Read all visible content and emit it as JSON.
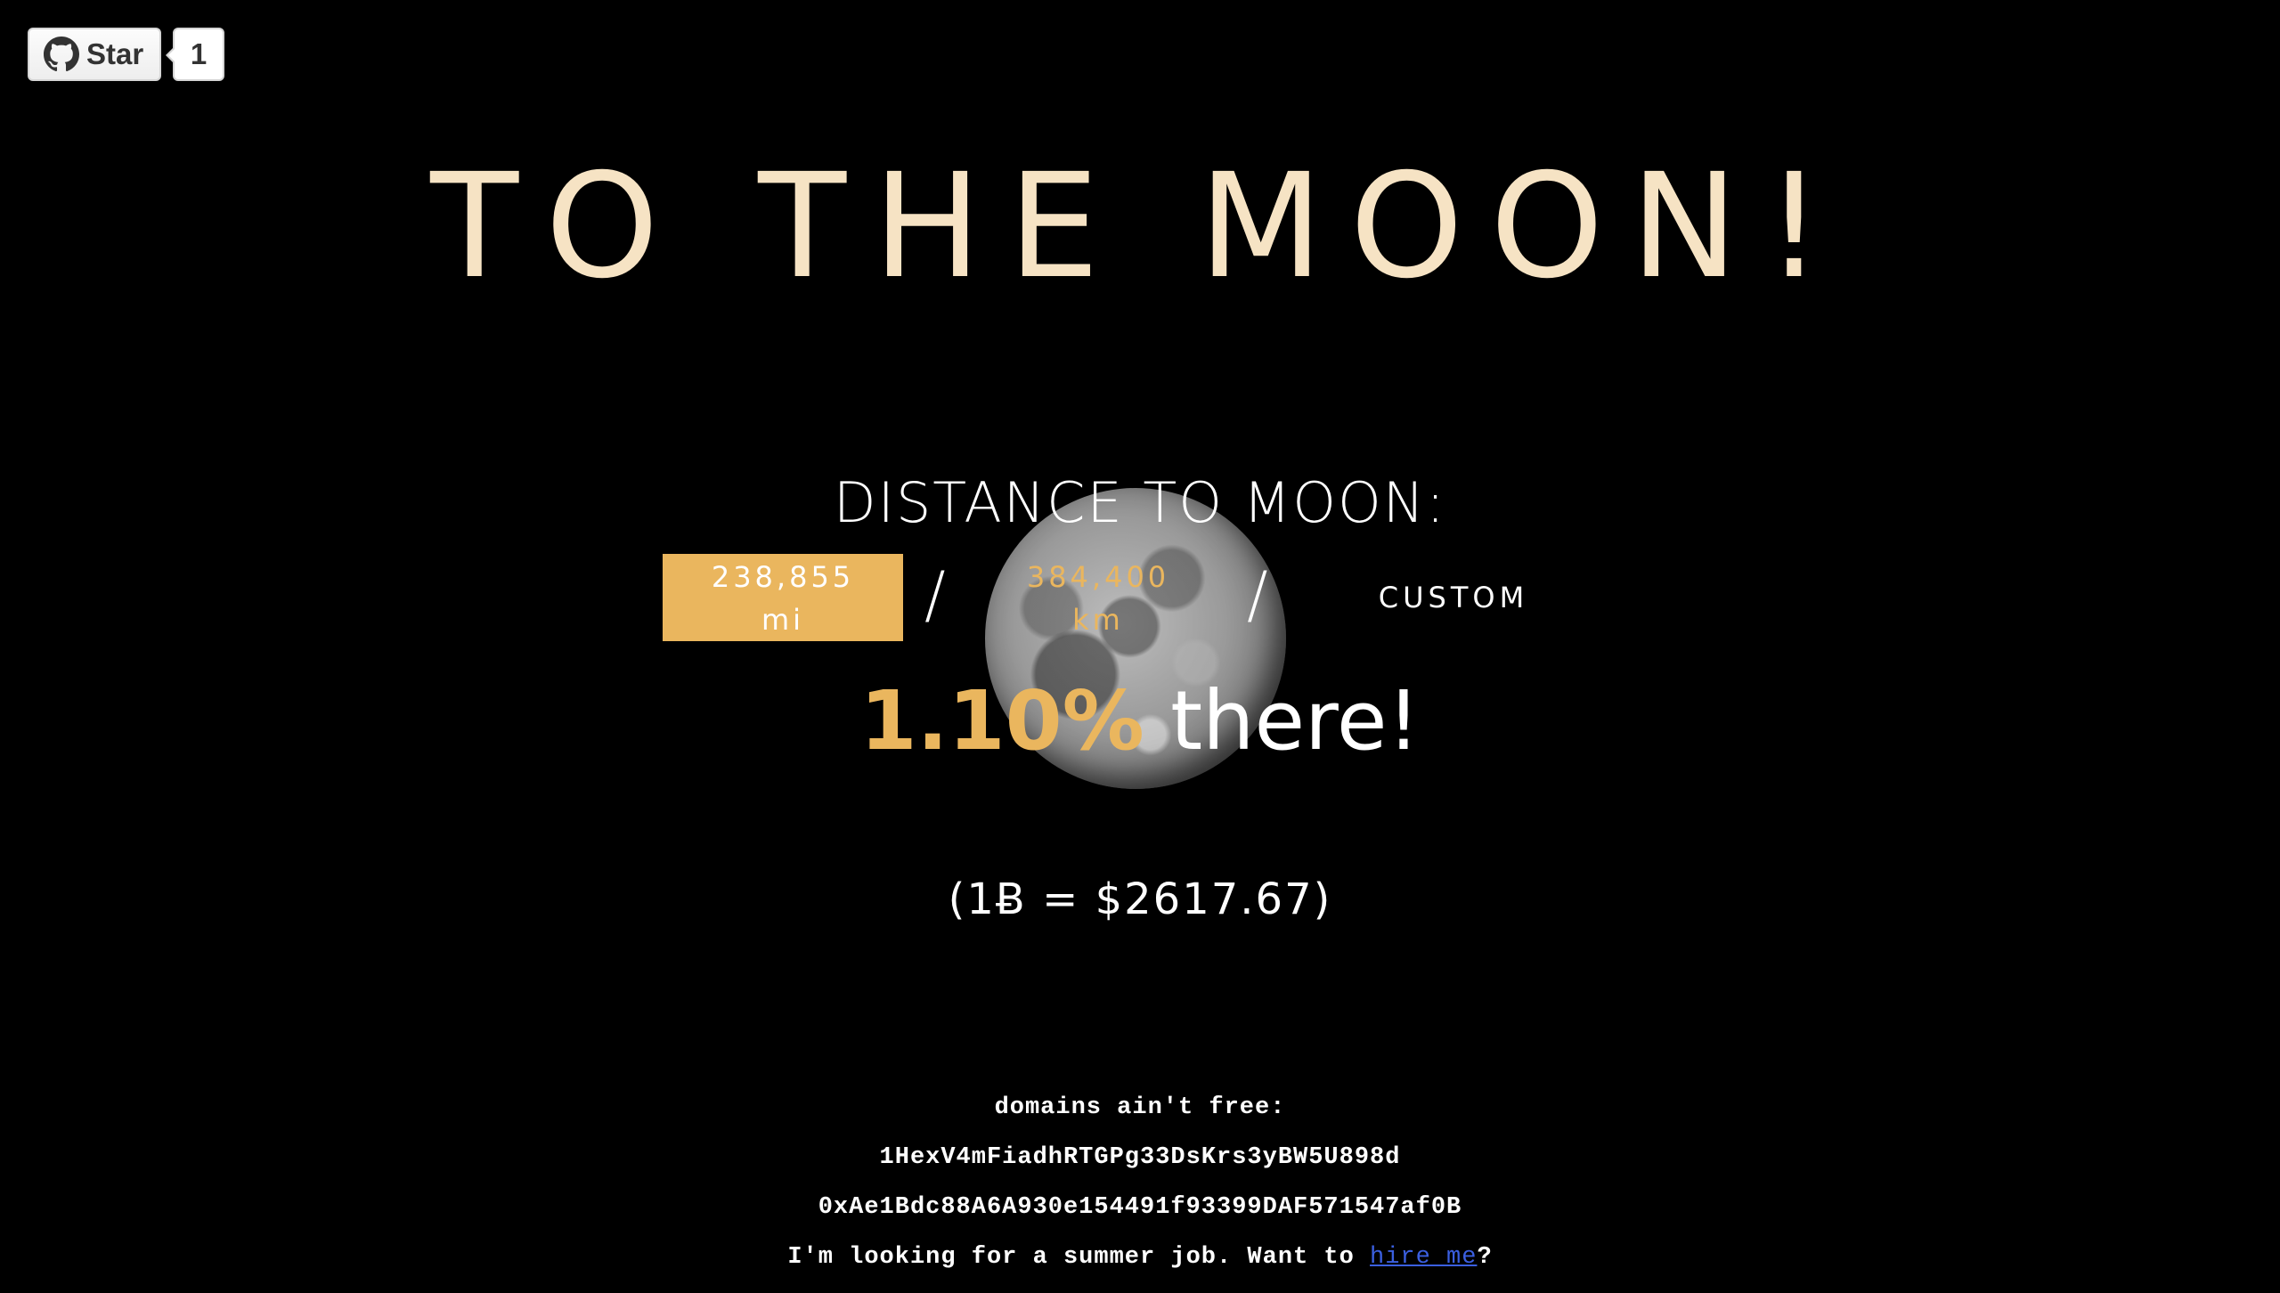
{
  "github": {
    "star_label": "Star",
    "star_count": "1"
  },
  "title": "TO THE MOON!",
  "distance": {
    "label": "DISTANCE TO MOON:",
    "units": [
      {
        "value": "238,855",
        "unit": "mi",
        "active": true
      },
      {
        "value": "384,400",
        "unit": "km",
        "active": false
      }
    ],
    "separator": "/",
    "custom_label": "CUSTOM"
  },
  "progress": {
    "percent_text": "1.10%",
    "percent_value": 1.1,
    "suffix": "there!"
  },
  "price": {
    "text": "(1Ƀ = $2617.67)"
  },
  "footer": {
    "domains_text": "domains ain't free:",
    "btc_address": "1HexV4mFiadhRTGPg33DsKrs3yBW5U898d",
    "eth_address": "0xAe1Bdc88A6A930e154491f93399DAF571547af0B",
    "job_text_before": "I'm looking for a summer job. Want to ",
    "job_link_text": "hire me",
    "job_text_after": "?"
  },
  "colors": {
    "background": "#000000",
    "title": "#f6e3c4",
    "accent": "#eab65e",
    "link": "#3b5fe0"
  },
  "icons": [
    "github-icon",
    "moon-image"
  ]
}
